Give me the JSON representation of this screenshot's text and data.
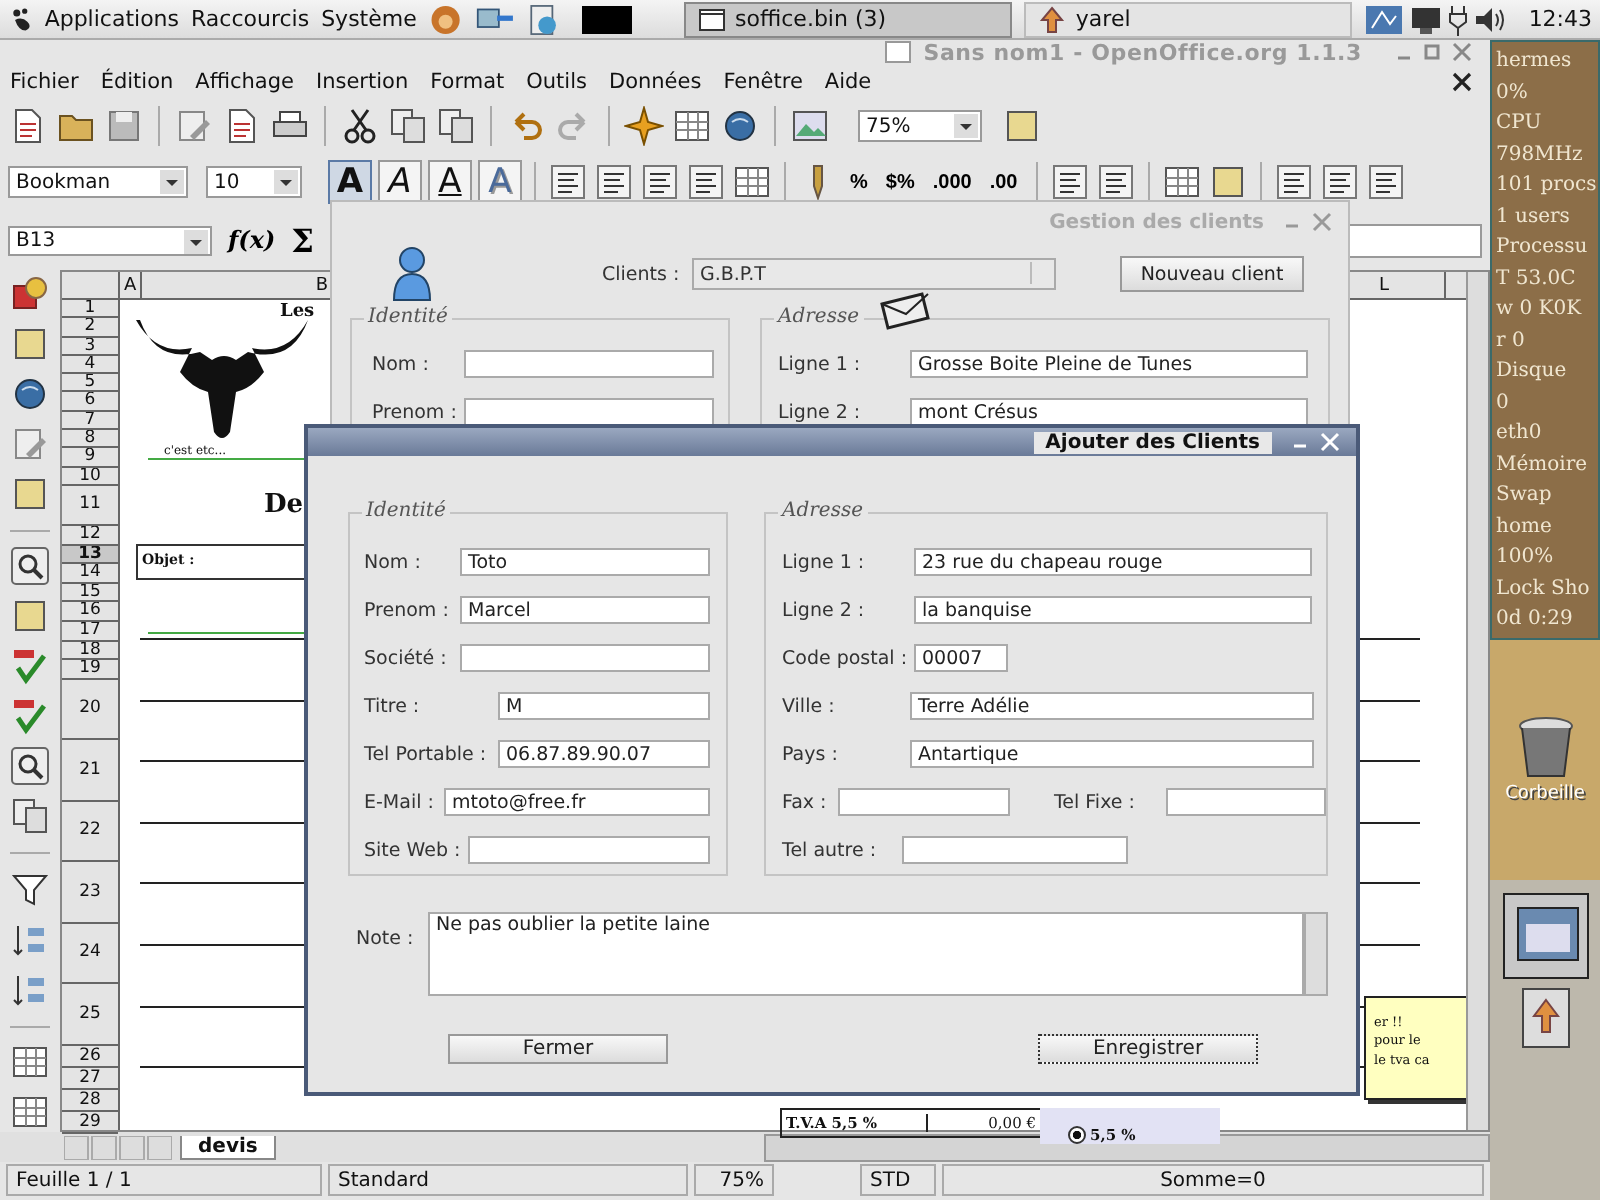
{
  "top_panel": {
    "menus": [
      "Applications",
      "Raccourcis",
      "Système"
    ],
    "tasks": [
      {
        "label": "soffice.bin (3)",
        "selected": true
      },
      {
        "label": "yarel",
        "selected": false
      }
    ],
    "clock": "12:43"
  },
  "window": {
    "title": "Sans nom1 - OpenOffice.org 1.1.3",
    "menu": [
      "Fichier",
      "Édition",
      "Affichage",
      "Insertion",
      "Format",
      "Outils",
      "Données",
      "Fenêtre",
      "Aide"
    ]
  },
  "toolbar": {
    "zoom": "75%"
  },
  "format_bar": {
    "font": "Bookman",
    "size": "10",
    "styles": [
      {
        "label": "A",
        "kind": "bold",
        "selected": true
      },
      {
        "label": "A",
        "kind": "italic",
        "selected": false
      },
      {
        "label": "A",
        "kind": "underline",
        "selected": false
      },
      {
        "label": "A",
        "kind": "shadow",
        "selected": false
      }
    ],
    "number_formats": [
      "%",
      "$%",
      ".000",
      ".00"
    ]
  },
  "formula_bar": {
    "cell_ref": "B13",
    "function_label": "f(x)",
    "sum_label": "Σ"
  },
  "sheet": {
    "columns": [
      "A",
      "B",
      "L"
    ],
    "rows": [
      "1",
      "2",
      "3",
      "4",
      "5",
      "6",
      "7",
      "8",
      "9",
      "10",
      "11",
      "12",
      "13",
      "14",
      "15",
      "16",
      "17",
      "18",
      "19",
      "20",
      "21",
      "22",
      "23",
      "24",
      "25",
      "26",
      "27",
      "28",
      "29"
    ],
    "header_text": "Les",
    "slogan": "c'est etc...",
    "heading": "De",
    "subject_label": "Objet :",
    "vat_label": "T.V.A  5,5 %",
    "vat_amount": "0,00 €",
    "vat_option": {
      "label": "5,5 %",
      "selected": true
    },
    "note_lines": [
      "er !!",
      "pour le",
      "le tva ca"
    ]
  },
  "sheet_tabs": [
    {
      "label": "devis",
      "selected": true
    }
  ],
  "status_bar": [
    "Feuille 1 / 1",
    "Standard",
    "75%",
    "STD",
    "Somme=0"
  ],
  "system_monitor": [
    "hermes",
    "0%",
    "CPU",
    "798MHz",
    "101 procs",
    "1 users",
    "Processu",
    "T  53.0C",
    "w 0  K0K",
    "r 0",
    "Disque",
    "0",
    "eth0",
    "Mémoire",
    "Swap",
    "home",
    "100%",
    "Lock  Sho",
    "0d  0:29"
  ],
  "desktop_icons": [
    {
      "label": "Corbeille"
    }
  ],
  "back_dialog": {
    "title": "Gestion des clients",
    "clients_label": "Clients :",
    "clients_value": "G.B.P.T",
    "new_button": "Nouveau client",
    "identity_title": "Identité",
    "identity_fields": [
      {
        "label": "Nom :"
      },
      {
        "label": "Prenom :"
      }
    ],
    "address_title": "Adresse",
    "address_fields": [
      {
        "label": "Ligne 1 :",
        "value": "Grosse Boite Pleine de Tunes"
      },
      {
        "label": "Ligne 2 :",
        "value": "mont Crésus"
      }
    ]
  },
  "front_dialog": {
    "title": "Ajouter des Clients",
    "identity_title": "Identité",
    "identity_fields": [
      {
        "label": "Nom :",
        "value": "Toto"
      },
      {
        "label": "Prenom :",
        "value": "Marcel"
      },
      {
        "label": "Société :"
      },
      {
        "label": "Titre :",
        "value": "M"
      },
      {
        "label": "Tel Portable :",
        "value": "06.87.89.90.07"
      },
      {
        "label": "E-Mail :",
        "value": "mtoto@free.fr"
      },
      {
        "label": "Site Web :"
      }
    ],
    "address_title": "Adresse",
    "address_rows": [
      [
        {
          "label": "Ligne 1 :",
          "value": "23 rue du chapeau rouge"
        }
      ],
      [
        {
          "label": "Ligne 2 :",
          "value": "la banquise"
        }
      ],
      [
        {
          "label": "Code postal :",
          "value": "00007"
        }
      ],
      [
        {
          "label": "Ville :",
          "value": "Terre Adélie"
        }
      ],
      [
        {
          "label": "Pays :",
          "value": "Antartique"
        }
      ],
      [
        {
          "label": "Fax :"
        },
        {
          "label": "Tel Fixe :"
        }
      ],
      [
        {
          "label": "Tel autre :"
        }
      ]
    ],
    "note_label": "Note :",
    "note_value": "Ne pas oublier la petite laine",
    "buttons": [
      {
        "label": "Fermer",
        "focused": false
      },
      {
        "label": "Enregistrer",
        "focused": true
      }
    ]
  }
}
